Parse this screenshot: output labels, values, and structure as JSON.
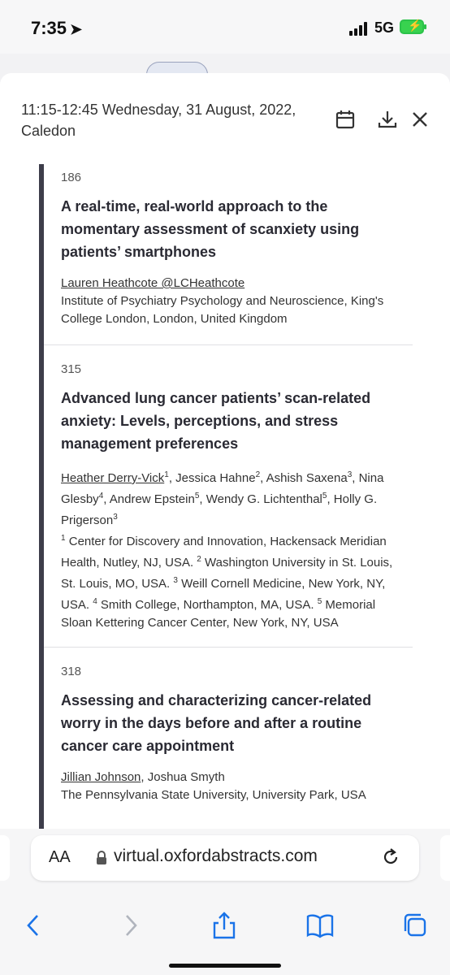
{
  "status": {
    "time": "7:35",
    "network": "5G"
  },
  "modal": {
    "header": "11:15-12:45 Wednesday, 31 August, 2022, Caledon",
    "items": [
      {
        "number": "186",
        "title": "A real-time, real-world approach to the momentary assessment of scanxiety using patients’ smartphones",
        "presenter": "Lauren Heathcote @LCHeathcote",
        "affiliation": "Institute of Psychiatry Psychology and Neuroscience, King's College London, London, United Kingdom"
      },
      {
        "number": "315",
        "title": "Advanced lung cancer patients’ scan-related anxiety: Levels, perceptions, and stress management preferences",
        "authors": [
          {
            "name": "Heather Derry-Vick",
            "sup": "1",
            "presenter": true
          },
          {
            "name": ", Jessica Hahne",
            "sup": "2"
          },
          {
            "name": ", Ashish Saxena",
            "sup": "3"
          },
          {
            "name": ", Nina Glesby",
            "sup": "4"
          },
          {
            "name": ", Andrew Epstein",
            "sup": "5"
          },
          {
            "name": ", Wendy G. Lichtenthal",
            "sup": "5"
          },
          {
            "name": ", Holly G. Prigerson",
            "sup": "3"
          }
        ],
        "affiliations": [
          {
            "sup": "1",
            "text": " Center for Discovery and Innovation, Hackensack Meridian Health, Nutley, NJ, USA. "
          },
          {
            "sup": "2",
            "text": " Washington University in St. Louis, St. Louis, MO, USA. "
          },
          {
            "sup": "3",
            "text": " Weill Cornell Medicine, New York, NY, USA. "
          },
          {
            "sup": "4",
            "text": " Smith College, Northampton, MA, USA. "
          },
          {
            "sup": "5",
            "text": " Memorial Sloan Kettering Cancer Center, New York, NY, USA"
          }
        ]
      },
      {
        "number": "318",
        "title": "Assessing and characterizing cancer-related worry in the days before and after a routine cancer care appointment",
        "presenter": "Jillian Johnson",
        "coauthors": ", Joshua Smyth",
        "affiliation": "The Pennsylvania State University, University Park, USA"
      }
    ]
  },
  "browser": {
    "text_size_label": "AA",
    "url": "virtual.oxfordabstracts.com"
  },
  "icons": {
    "calendar": "calendar-icon",
    "download": "download-icon",
    "close": "close-icon",
    "lock": "lock-icon",
    "reload": "reload-icon",
    "back": "back-icon",
    "forward": "forward-icon",
    "share": "share-icon",
    "bookmarks": "bookmarks-icon",
    "tabs": "tabs-icon"
  },
  "colors": {
    "accent_bar": "#3d3d4a",
    "icon": "#333333",
    "safari_blue": "#1a73e8",
    "battery": "#38d24f"
  }
}
